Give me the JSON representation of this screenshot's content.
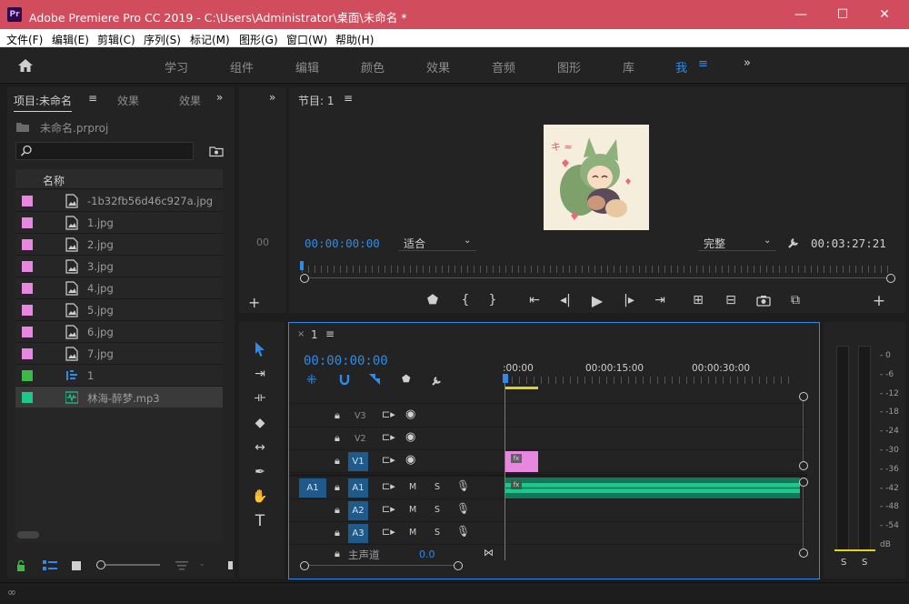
{
  "window": {
    "title": "Adobe Premiere Pro CC 2019 - C:\\Users\\Administrator\\桌面\\未命名 *",
    "app_icon": "Pr"
  },
  "menu": [
    "文件(F)",
    "编辑(E)",
    "剪辑(C)",
    "序列(S)",
    "标记(M)",
    "图形(G)",
    "窗口(W)",
    "帮助(H)"
  ],
  "workspaces": [
    "学习",
    "组件",
    "编辑",
    "颜色",
    "效果",
    "音频",
    "图形",
    "库",
    "我"
  ],
  "project": {
    "tabs": [
      "项目:未命名",
      "效果",
      "效果"
    ],
    "file": "未命名.prproj",
    "column_header": "名称",
    "items": [
      {
        "name": "-1b32fb56d46c927a.jpg",
        "color": "#e887e0",
        "icon": "image-file-icon"
      },
      {
        "name": "1.jpg",
        "color": "#e887e0",
        "icon": "image-file-icon"
      },
      {
        "name": "2.jpg",
        "color": "#e887e0",
        "icon": "image-file-icon"
      },
      {
        "name": "3.jpg",
        "color": "#e887e0",
        "icon": "image-file-icon"
      },
      {
        "name": "4.jpg",
        "color": "#e887e0",
        "icon": "image-file-icon"
      },
      {
        "name": "5.jpg",
        "color": "#e887e0",
        "icon": "image-file-icon"
      },
      {
        "name": "6.jpg",
        "color": "#e887e0",
        "icon": "image-file-icon"
      },
      {
        "name": "7.jpg",
        "color": "#e887e0",
        "icon": "image-file-icon"
      },
      {
        "name": "1",
        "color": "#3fb84a",
        "icon": "sequence-icon"
      },
      {
        "name": "林海-醉梦.mp3",
        "color": "#1dc98a",
        "icon": "audio-file-icon"
      }
    ]
  },
  "program": {
    "title": "节目: 1",
    "timecode": "00:00:00:00",
    "fit": "适合",
    "quality": "完整",
    "duration": "00:03:27:21"
  },
  "timeline": {
    "sequence": "1",
    "timecode": "00:00:00:00",
    "ruler": [
      ":00:00",
      "00:00:15:00",
      "00:00:30:00"
    ],
    "video_tracks": [
      "V3",
      "V2",
      "V1"
    ],
    "audio_tracks": [
      "A1",
      "A2",
      "A3"
    ],
    "source_patch": "A1",
    "mute_label": "M",
    "solo_label": "S",
    "master": {
      "label": "主声道",
      "value": "0.0"
    }
  },
  "meter": {
    "scale": [
      "- 0",
      "- -6",
      "- -12",
      "- -18",
      "- -24",
      "- -30",
      "- -36",
      "- -42",
      "- -48",
      "- -54",
      "dB"
    ],
    "solo": [
      "S",
      "S"
    ]
  },
  "colors": {
    "accent": "#2d8ceb",
    "titlebar": "#d14c5c",
    "video_clip": "#e887e0",
    "audio_clip": "#1dc98a"
  }
}
